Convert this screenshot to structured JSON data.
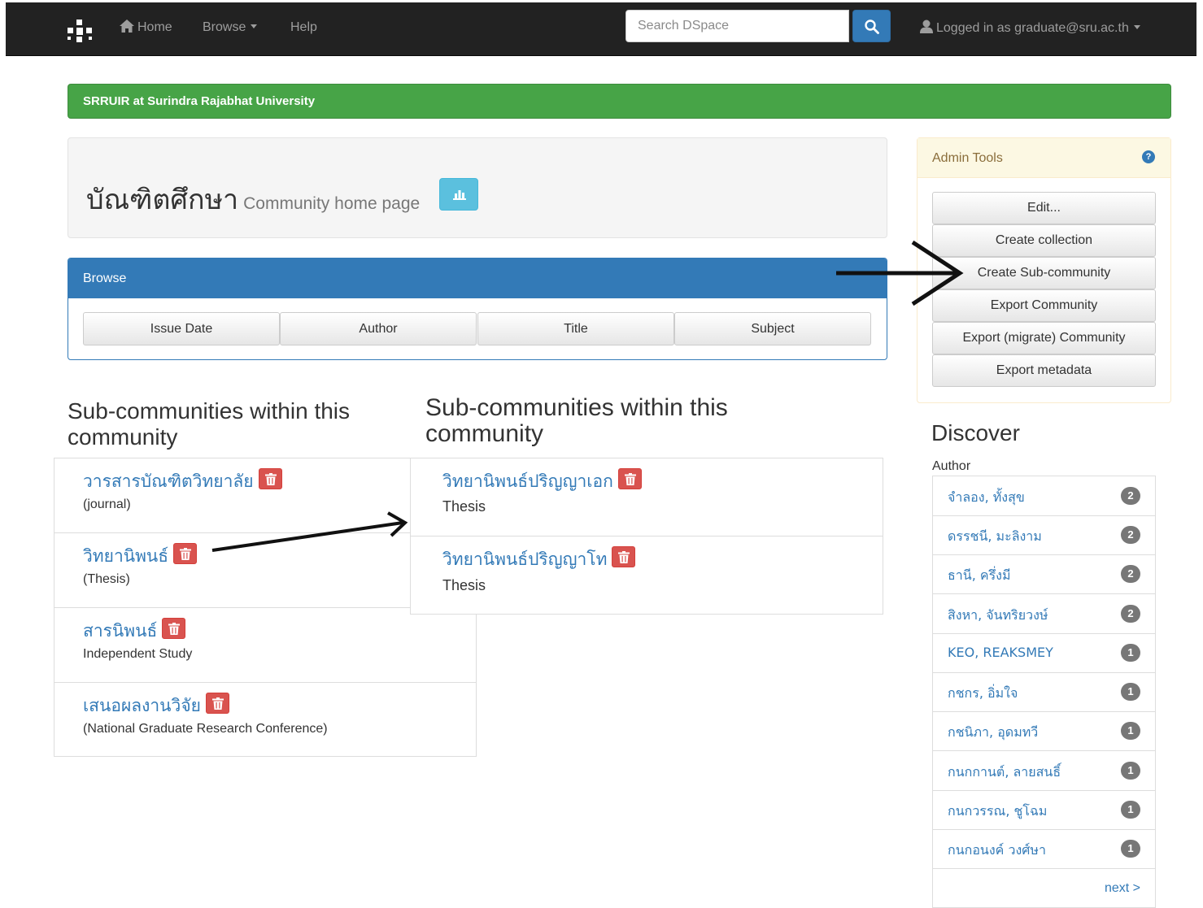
{
  "navbar": {
    "home_label": "Home",
    "browse_label": "Browse",
    "help_label": "Help",
    "search_placeholder": "Search DSpace",
    "user_label": "Logged in as graduate@sru.ac.th"
  },
  "trail": {
    "label": "SRRUIR at Surindra Rajabhat University"
  },
  "header": {
    "title": "บัณฑิตศึกษา",
    "subtitle": "Community home page"
  },
  "browse": {
    "heading": "Browse",
    "buttons": [
      "Issue Date",
      "Author",
      "Title",
      "Subject"
    ]
  },
  "subcommunities": {
    "title": "Sub-communities within this community",
    "left_items": [
      {
        "name": "วารสารบัณฑิตวิทยาลัย",
        "desc": "(journal)"
      },
      {
        "name": "วิทยานิพนธ์",
        "desc": "(Thesis)"
      },
      {
        "name": "สารนิพนธ์",
        "desc": "Independent Study"
      },
      {
        "name": "เสนอผลงานวิจัย",
        "desc": "(National Graduate Research Conference)"
      }
    ],
    "right_items": [
      {
        "name": "วิทยานิพนธ์ปริญญาเอก",
        "desc": "Thesis"
      },
      {
        "name": "วิทยานิพนธ์ปริญญาโท",
        "desc": "Thesis"
      }
    ]
  },
  "admin": {
    "heading": "Admin Tools",
    "help": "?",
    "buttons": [
      "Edit...",
      "Create collection",
      "Create Sub-community",
      "Export Community",
      "Export (migrate) Community",
      "Export metadata"
    ]
  },
  "discover": {
    "title": "Discover",
    "facet_title": "Author",
    "facets": [
      {
        "name": "จำลอง, ทั้งสุข",
        "count": "2"
      },
      {
        "name": "ดรรชนี, มะลิงาม",
        "count": "2"
      },
      {
        "name": "ธานี, ครึ่งมี",
        "count": "2"
      },
      {
        "name": "สิงหา, จันทริยวงษ์",
        "count": "2"
      },
      {
        "name": "KEO, REAKSMEY",
        "count": "1"
      },
      {
        "name": "กชกร, อิ่มใจ",
        "count": "1"
      },
      {
        "name": "กชนิภา, อุดมทวี",
        "count": "1"
      },
      {
        "name": "กนกกานต์, ลายสนธิ์",
        "count": "1"
      },
      {
        "name": "กนกวรรณ, ชูโฉม",
        "count": "1"
      },
      {
        "name": "กนกอนงค์ วงศ์ษา",
        "count": "1"
      }
    ],
    "next_label": "next >"
  },
  "colors": {
    "navbar": "#222222",
    "trail": "#47a447",
    "primary": "#337ab7",
    "danger": "#d9534f",
    "warning_bg": "#fcf8e3",
    "info": "#5bc0de"
  }
}
